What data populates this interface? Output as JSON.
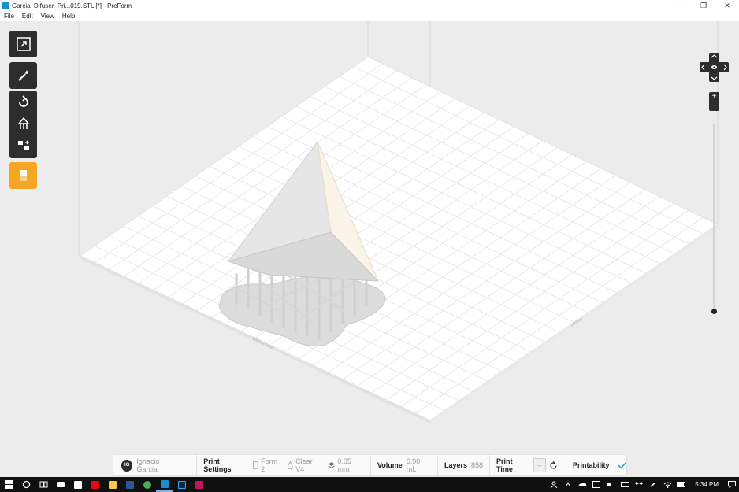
{
  "window": {
    "title": "Garcia_Difuser_Pri...019.STL [*] - PreForm",
    "minimize": "─",
    "maximize": "❐",
    "close": "✕"
  },
  "menu": [
    "File",
    "Edit",
    "View",
    "Help"
  ],
  "toolbar": {
    "tools": [
      {
        "name": "scale-view-tool",
        "icon": "expand-icon"
      },
      {
        "name": "magic-wand-tool",
        "icon": "magic-wand-icon"
      },
      {
        "name": "orientation-tool",
        "icon": "rotate-icon"
      },
      {
        "name": "supports-tool",
        "icon": "supports-icon"
      },
      {
        "name": "layout-tool",
        "icon": "layout-icon"
      },
      {
        "name": "print-tool",
        "icon": "print-icon"
      }
    ],
    "accent_color": "#f5a623"
  },
  "build_platform": {
    "left_label": "WIPER SIDE",
    "right_label": "FRONT"
  },
  "zoom": {
    "plus": "+",
    "minus": "−"
  },
  "status": {
    "user_initials": "IG",
    "user_name": "Ignacio Garcia",
    "print_settings_label": "Print Settings",
    "printer": "Form 2",
    "material": "Clear V4",
    "layer_height": "0.05 mm",
    "volume_label": "Volume",
    "volume_value": "6.90 mL",
    "layers_label": "Layers",
    "layers_value": "858",
    "print_time_label": "Print Time",
    "print_time_value": "--",
    "printability_label": "Printability",
    "printability_color": "#2aa1d8"
  },
  "taskbar": {
    "apps": [
      {
        "name": "start-button",
        "color": "#ffffff"
      },
      {
        "name": "search-button",
        "color": "#ffffff"
      },
      {
        "name": "task-view-button",
        "color": "#ffffff"
      },
      {
        "name": "mail-app",
        "color": "#ffffff"
      },
      {
        "name": "store-app",
        "color": "#ffffff"
      },
      {
        "name": "netflix-app",
        "color": "#e50914"
      },
      {
        "name": "file-explorer-app",
        "color": "#f7c948"
      },
      {
        "name": "word-app",
        "color": "#2b579a"
      },
      {
        "name": "chrome-app",
        "color": "#4caf50"
      },
      {
        "name": "preform-app",
        "color": "#1a8fd0"
      },
      {
        "name": "photoshop-app",
        "color": "#31a8ff"
      },
      {
        "name": "other-app",
        "color": "#c2185b"
      }
    ],
    "time": "5:34 PM"
  }
}
